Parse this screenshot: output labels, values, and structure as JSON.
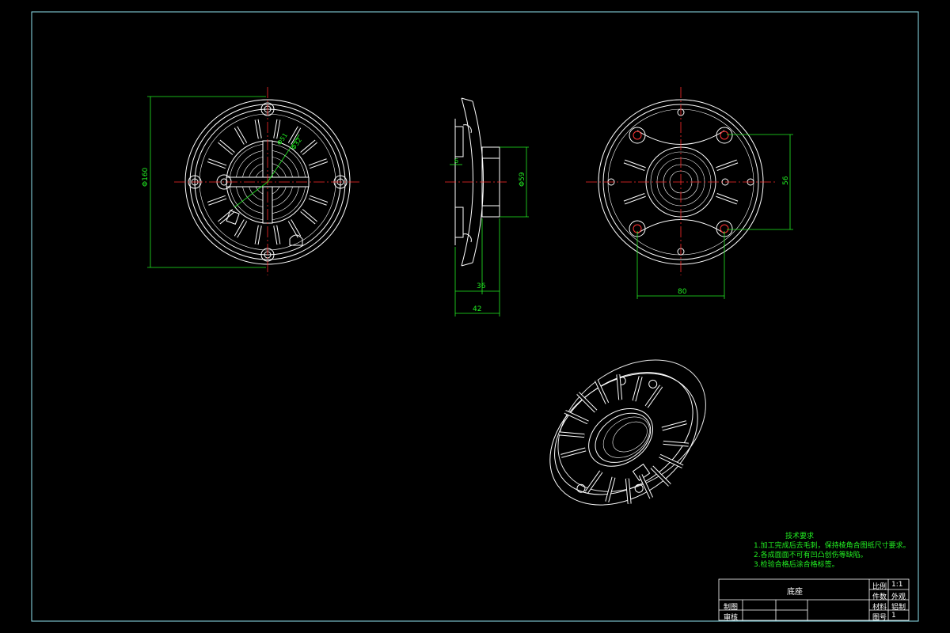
{
  "colors": {
    "background": "#000000",
    "frame": "#8fe3f0",
    "part_lines": "#ffffff",
    "center_lines": "#ff2b2b",
    "dimensions": "#22ee22",
    "holes": "#ff3333"
  },
  "dimensions": {
    "front_diameter": "Φ160",
    "hole_diameter_1": "Φ51",
    "hole_diameter_2": "Φ32",
    "side_small": "6",
    "side_diameter": "Φ59",
    "side_depth_1": "36",
    "side_depth_2": "42",
    "rear_vertical": "56",
    "rear_horizontal": "80"
  },
  "technical_notes": {
    "title": "技术要求",
    "items": [
      "1.加工完成后去毛刺，保持棱角合图纸尺寸要求。",
      "2.各成面面不可有凹凸创伤等缺陷。",
      "3.检验合格后涂合格标签。"
    ]
  },
  "title_block": {
    "part_name": "底座",
    "label_scale": "比例",
    "value_scale": "1:1",
    "label_quantity": "件数",
    "value_quantity": "外观",
    "label_material": "材料",
    "value_material": "铝制",
    "label_drawing_no": "图号",
    "value_drawing_no": "1",
    "label_drawn": "制图",
    "label_checked": "审核"
  }
}
